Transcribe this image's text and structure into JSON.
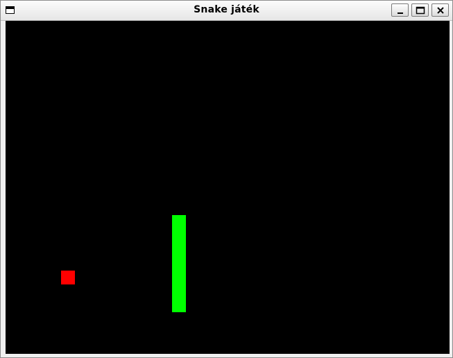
{
  "window": {
    "title": "Snake játék"
  },
  "icons": {
    "app": "window-icon",
    "minimize": "minimize-icon",
    "maximize": "maximize-icon",
    "close": "close-icon"
  },
  "colors": {
    "background": "#000000",
    "snake": "#00ff00",
    "food": "#ff0000"
  }
}
